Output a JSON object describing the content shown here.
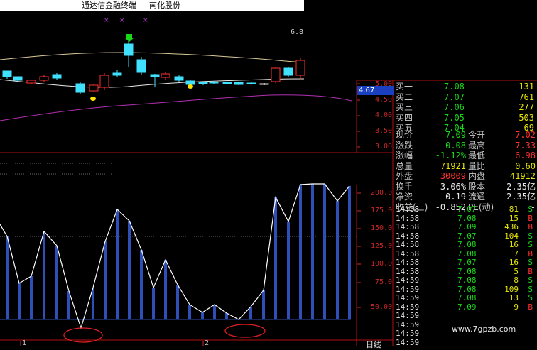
{
  "window": {
    "title": "通达信金融终端",
    "stock_name": "南化股份"
  },
  "price_chart": {
    "axis_labels": [
      "6.8",
      "5.00",
      "4.50",
      "4.00",
      "3.50",
      "3.00"
    ],
    "current_price_tag": "4.67",
    "markers": [
      "×",
      "×",
      "×"
    ]
  },
  "indicator_chart": {
    "axis_labels": [
      "200.0",
      "175.0",
      "150.0",
      "125.0",
      "100.0",
      "75.0",
      "50.00"
    ],
    "bottom_labels": [
      "1",
      "2"
    ],
    "period_label": "日线"
  },
  "order_book": [
    {
      "label": "买一",
      "price": "7.08",
      "volume": "131"
    },
    {
      "label": "买二",
      "price": "7.07",
      "volume": "761"
    },
    {
      "label": "买三",
      "price": "7.06",
      "volume": "277"
    },
    {
      "label": "买四",
      "price": "7.05",
      "volume": "503"
    },
    {
      "label": "买五",
      "price": "7.04",
      "volume": "69"
    }
  ],
  "quote_stats": [
    {
      "l1": "现价",
      "v1": "7.09",
      "l2": "今开",
      "v2": "7.02"
    },
    {
      "l1": "涨跌",
      "v1": "-0.08",
      "l2": "最高",
      "v2": "7.33"
    },
    {
      "l1": "涨幅",
      "v1": "-1.12%",
      "l2": "最低",
      "v2": "6.98"
    },
    {
      "l1": "总量",
      "v1": "71921",
      "l2": "量比",
      "v2": "0.60"
    },
    {
      "l1": "外盘",
      "v1": "30009",
      "l2": "内盘",
      "v2": "41912"
    },
    {
      "l1": "换手",
      "v1": "3.06%",
      "l2": "股本",
      "v2": "2.35亿"
    },
    {
      "l1": "净资",
      "v1": "0.19",
      "l2": "流通",
      "v2": "2.35亿"
    },
    {
      "l1": "收益(三)",
      "v1": "-0.852",
      "l2": "PE(动)",
      "v2": "-"
    }
  ],
  "ticks": [
    {
      "time": "14:58",
      "price": "7.07",
      "vol": "81",
      "side": "S"
    },
    {
      "time": "14:58",
      "price": "7.08",
      "vol": "15",
      "side": "B"
    },
    {
      "time": "14:58",
      "price": "7.09",
      "vol": "436",
      "side": "B"
    },
    {
      "time": "14:58",
      "price": "7.07",
      "vol": "104",
      "side": "S"
    },
    {
      "time": "14:58",
      "price": "7.08",
      "vol": "16",
      "side": "S"
    },
    {
      "time": "14:58",
      "price": "7.08",
      "vol": "7",
      "side": "B"
    },
    {
      "time": "14:58",
      "price": "7.07",
      "vol": "16",
      "side": "S"
    },
    {
      "time": "14:58",
      "price": "7.08",
      "vol": "5",
      "side": "B"
    },
    {
      "time": "14:59",
      "price": "7.08",
      "vol": "8",
      "side": "S"
    },
    {
      "time": "14:59",
      "price": "7.08",
      "vol": "109",
      "side": "S"
    },
    {
      "time": "14:59",
      "price": "7.08",
      "vol": "13",
      "side": "S"
    },
    {
      "time": "14:59",
      "price": "7.09",
      "vol": "9",
      "side": "B"
    },
    {
      "time": "14:59",
      "price": "",
      "vol": "",
      "side": ""
    },
    {
      "time": "14:59",
      "price": "",
      "vol": "",
      "side": ""
    },
    {
      "time": "14:59",
      "price": "",
      "vol": "",
      "side": ""
    },
    {
      "time": "14:59",
      "price": "",
      "vol": "",
      "side": ""
    }
  ],
  "watermark": "www.7gpzb.com",
  "colors": {
    "up": "#ff3030",
    "down": "#18d818",
    "neutral": "#e8e8e8",
    "axis": "#c62828",
    "candle_down_fill": "#40e0ff",
    "ma_line": "#d8c898",
    "purple_line": "#b030b0",
    "bar": "#2f4fb8"
  }
}
